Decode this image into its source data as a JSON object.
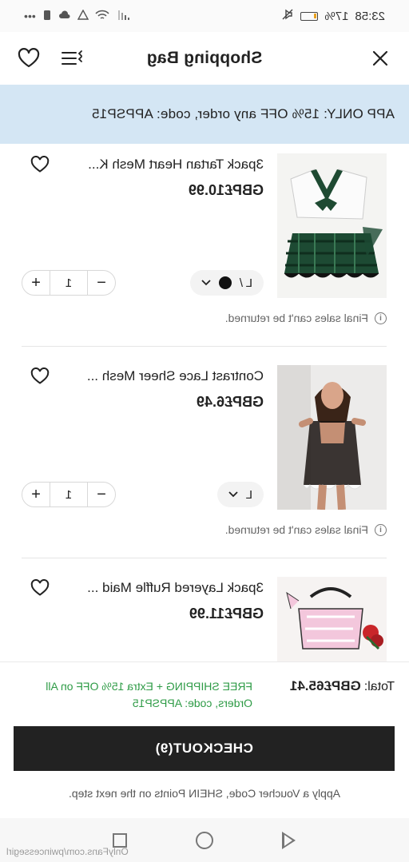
{
  "status_bar": {
    "time": "23:58",
    "battery": "17%",
    "icons": [
      "mute-icon",
      "battery-icon",
      "wifi-icon",
      "signal-icon",
      "alarm-icon",
      "cloud-icon",
      "notification-icon",
      "more-dots-icon"
    ]
  },
  "header": {
    "title": "Shopping Bag",
    "icons": [
      "close-icon",
      "list-filter-icon",
      "heart-icon"
    ]
  },
  "promo": {
    "text": "APP ONLY: 15% OFF any order, code: APPSP15"
  },
  "items": [
    {
      "name": "3pack Tartan Heart Mesh K...",
      "price": "GBP£10.99",
      "variant": "L /",
      "has_color_dot": true,
      "qty": "1",
      "notice": "Final sales can't be returned."
    },
    {
      "name": "Contrast Lace Sheer Mesh ...",
      "price": "GBP£6.49",
      "variant": "L",
      "has_color_dot": false,
      "qty": "1",
      "notice": "Final sales can't be returned."
    },
    {
      "name": "3pack Layered Ruffle Maid ...",
      "price": "GBP£11.99"
    }
  ],
  "footer": {
    "total_label": "Total:",
    "total_value": "GBP£65.41",
    "free_shipping": "FREE SHIPPING + Extra 15% OFF on All Orders, code: APPSP15",
    "checkout_label": "CHECKOUT(9)",
    "apply_text": "Apply a Voucher Code, SHEIN Points on the next step."
  },
  "watermark": "OnlyFans.com/pwincessegirl",
  "colors": {
    "promo_bg": "#d4e6f4",
    "checkout_bg": "#222222",
    "free_shipping": "#2e9b46"
  }
}
